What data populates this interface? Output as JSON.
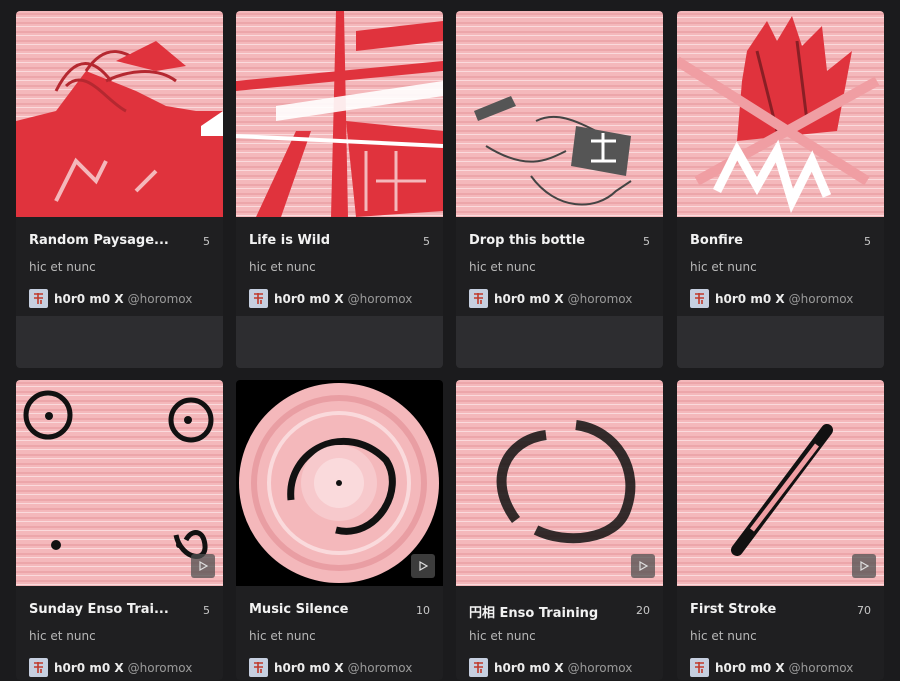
{
  "cards": [
    {
      "title": "Random Paysage...",
      "count": "5",
      "description": "hic et nunc",
      "author_name": "h0r0 m0 X",
      "author_handle": "@horomox",
      "artwork": "red-landscape-art",
      "has_play": false
    },
    {
      "title": "Life is Wild",
      "count": "5",
      "description": "hic et nunc",
      "author_name": "h0r0 m0 X",
      "author_handle": "@horomox",
      "artwork": "red-tree-branches-art",
      "has_play": false
    },
    {
      "title": "Drop this bottle",
      "count": "5",
      "description": "hic et nunc",
      "author_name": "h0r0 m0 X",
      "author_handle": "@horomox",
      "artwork": "bottle-art",
      "has_play": false
    },
    {
      "title": "Bonfire",
      "count": "5",
      "description": "hic et nunc",
      "author_name": "h0r0 m0 X",
      "author_handle": "@horomox",
      "artwork": "bonfire-art",
      "has_play": false
    },
    {
      "title": "Sunday Enso Trai...",
      "count": "5",
      "description": "hic et nunc",
      "author_name": "h0r0 m0 X",
      "author_handle": "@horomox",
      "artwork": "enso-circles-art",
      "has_play": true
    },
    {
      "title": "Music Silence",
      "count": "10",
      "description": "hic et nunc",
      "author_name": "h0r0 m0 X",
      "author_handle": "@horomox",
      "artwork": "vinyl-record-art",
      "has_play": true
    },
    {
      "title": "円相 Enso Training",
      "count": "20",
      "description": "hic et nunc",
      "author_name": "h0r0 m0 X",
      "author_handle": "@horomox",
      "artwork": "enso-brush-circle-art",
      "has_play": true
    },
    {
      "title": "First Stroke",
      "count": "70",
      "description": "hic et nunc",
      "author_name": "h0r0 m0 X",
      "author_handle": "@horomox",
      "artwork": "brush-stroke-art",
      "has_play": true
    }
  ],
  "colors": {
    "background": "#1b1b1d",
    "card": "#1f1f21",
    "accent_red": "#e23a44",
    "pink": "#f4b6ba"
  },
  "icons": {
    "avatar": "avatar-icon",
    "play": "play-icon"
  }
}
